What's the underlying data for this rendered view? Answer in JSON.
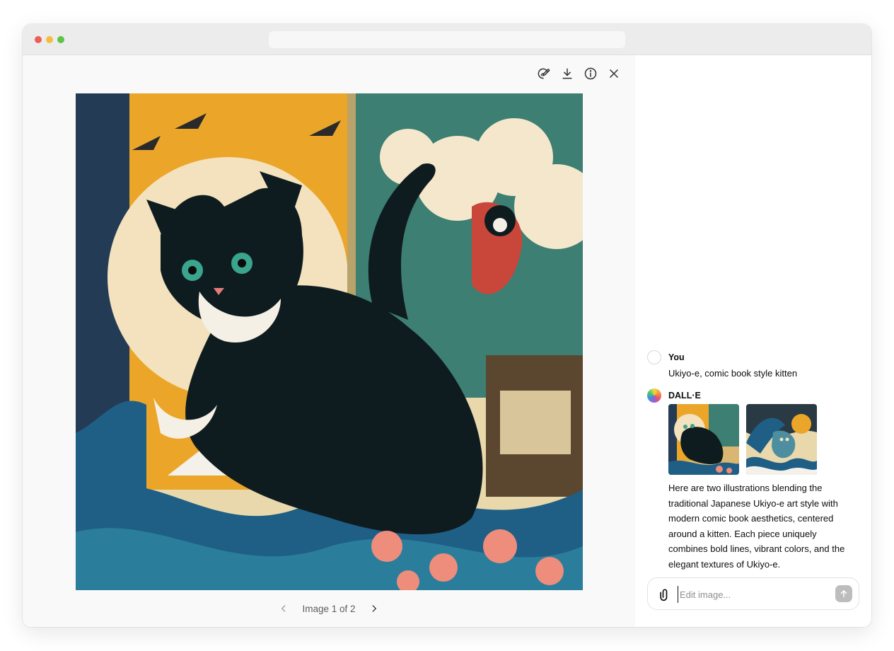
{
  "viewer": {
    "toolbar": {
      "edit_icon": "edit-brush-icon",
      "download_icon": "download-icon",
      "info_icon": "info-icon",
      "close_icon": "close-icon"
    },
    "pager": {
      "label": "Image 1 of 2",
      "prev_icon": "chevron-left-icon",
      "next_icon": "chevron-right-icon"
    }
  },
  "chat": {
    "user": {
      "name": "You",
      "text": "Ukiyo-e, comic book style kitten"
    },
    "assistant": {
      "name": "DALL·E",
      "reply": "Here are two illustrations blending the traditional Japanese Ukiyo-e art style with modern comic book aesthetics, centered around a kitten. Each piece uniquely combines bold lines, vibrant colors, and the elegant textures of Ukiyo-e."
    },
    "composer": {
      "placeholder": "Edit image...",
      "attach_icon": "paperclip-icon",
      "send_icon": "arrow-up-icon"
    }
  },
  "colors": {
    "send_button": "#bdbdbd",
    "window_chrome": "#ececec",
    "viewer_bg": "#f9f9f9"
  }
}
